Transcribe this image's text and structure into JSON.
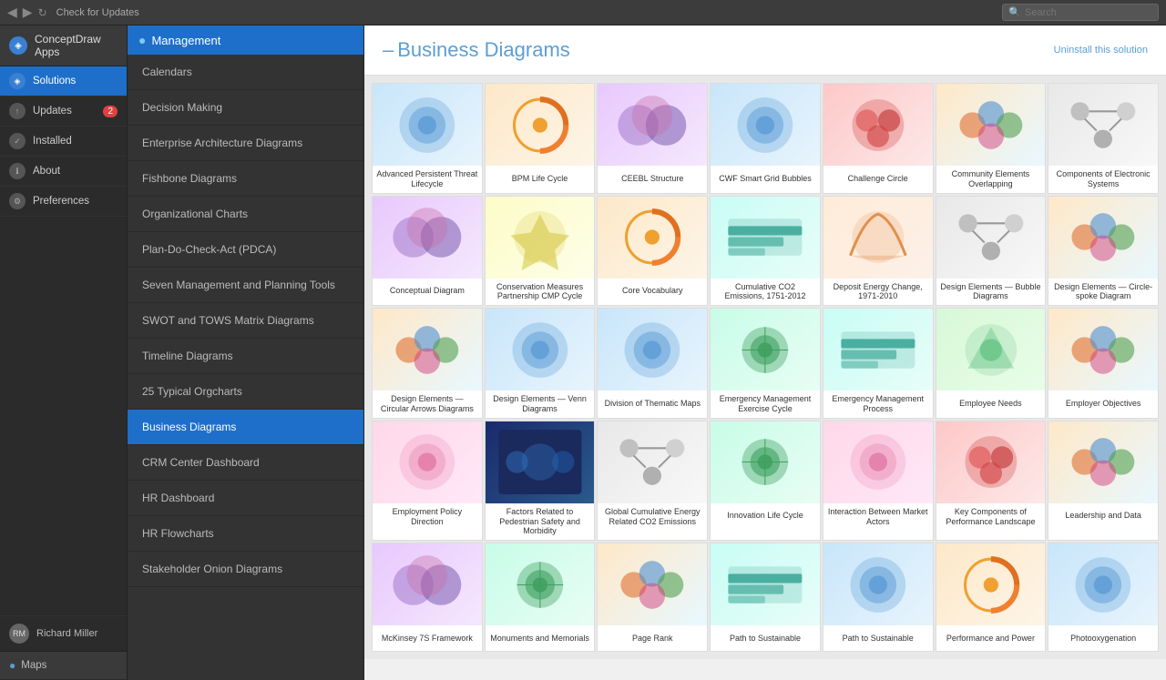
{
  "topbar": {
    "back_label": "◀",
    "forward_label": "▶",
    "refresh_label": "↻",
    "check_label": "Check for Updates",
    "search_placeholder": "Search"
  },
  "sidebar": {
    "app_label": "ConceptDraw Apps",
    "nav_items": [
      {
        "id": "solutions",
        "label": "Solutions",
        "icon": "●",
        "active": true
      },
      {
        "id": "updates",
        "label": "Updates",
        "icon": "↑",
        "badge": "2"
      },
      {
        "id": "installed",
        "label": "Installed",
        "icon": "✓"
      },
      {
        "id": "about",
        "label": "About",
        "icon": "i"
      },
      {
        "id": "preferences",
        "label": "Preferences",
        "icon": "⚙"
      }
    ],
    "user_label": "Richard Miller",
    "bottom_item_label": "Maps"
  },
  "middle_panel": {
    "header_label": "Management",
    "items": [
      {
        "label": "Calendars",
        "active": false
      },
      {
        "label": "Decision Making",
        "active": false
      },
      {
        "label": "Enterprise Architecture Diagrams",
        "active": false
      },
      {
        "label": "Fishbone Diagrams",
        "active": false
      },
      {
        "label": "Organizational Charts",
        "active": false
      },
      {
        "label": "Plan-Do-Check-Act (PDCA)",
        "active": false
      },
      {
        "label": "Seven Management and Planning Tools",
        "active": false
      },
      {
        "label": "SWOT and TOWS Matrix Diagrams",
        "active": false
      },
      {
        "label": "Timeline Diagrams",
        "active": false
      },
      {
        "label": "25 Typical Orgcharts",
        "active": false
      },
      {
        "label": "Business Diagrams",
        "active": true
      },
      {
        "label": "CRM Center Dashboard",
        "active": false
      },
      {
        "label": "HR Dashboard",
        "active": false
      },
      {
        "label": "HR Flowcharts",
        "active": false
      },
      {
        "label": "Stakeholder Onion Diagrams",
        "active": false
      }
    ]
  },
  "content": {
    "title": "Business Diagrams",
    "uninstall_label": "Uninstall this solution",
    "grid_items": [
      {
        "label": "Advanced Persistent Threat Lifecycle",
        "thumb": "blue"
      },
      {
        "label": "BPM Life Cycle",
        "thumb": "orange"
      },
      {
        "label": "CEEBL Structure",
        "thumb": "purple"
      },
      {
        "label": "CWF Smart Grid Bubbles",
        "thumb": "blue"
      },
      {
        "label": "Challenge Circle",
        "thumb": "red"
      },
      {
        "label": "Community Elements Overlapping",
        "thumb": "multi"
      },
      {
        "label": "Components of Electronic Systems",
        "thumb": "gray"
      },
      {
        "label": "Conceptual Diagram",
        "thumb": "purple"
      },
      {
        "label": "Conservation Measures Partnership CMP Cycle",
        "thumb": "yellow"
      },
      {
        "label": "Core Vocabulary",
        "thumb": "orange"
      },
      {
        "label": "Cumulative CO2 Emissions, 1751-2012",
        "thumb": "teal"
      },
      {
        "label": "Deposit Energy Change, 1971-2010",
        "thumb": "warm"
      },
      {
        "label": "Design Elements — Bubble Diagrams",
        "thumb": "gray"
      },
      {
        "label": "Design Elements — Circle-spoke Diagram",
        "thumb": "multi"
      },
      {
        "label": "Design Elements — Circular Arrows Diagrams",
        "thumb": "multi"
      },
      {
        "label": "Design Elements — Venn Diagrams",
        "thumb": "blue"
      },
      {
        "label": "Division of Thematic Maps",
        "thumb": "blue"
      },
      {
        "label": "Emergency Management Exercise Cycle",
        "thumb": "green"
      },
      {
        "label": "Emergency Management Process",
        "thumb": "teal"
      },
      {
        "label": "Employee Needs",
        "thumb": "lightgreen"
      },
      {
        "label": "Employer Objectives",
        "thumb": "multi"
      },
      {
        "label": "Employment Policy Direction",
        "thumb": "pink"
      },
      {
        "label": "Factors Related to Pedestrian Safety and Morbidity",
        "thumb": "darkblue"
      },
      {
        "label": "Global Cumulative Energy Related CO2 Emissions",
        "thumb": "gray"
      },
      {
        "label": "Innovation Life Cycle",
        "thumb": "green"
      },
      {
        "label": "Interaction Between Market Actors",
        "thumb": "pink"
      },
      {
        "label": "Key Components of Performance Landscape",
        "thumb": "red"
      },
      {
        "label": "Leadership and Data",
        "thumb": "multi"
      },
      {
        "label": "McKinsey 7S Framework",
        "thumb": "purple"
      },
      {
        "label": "Monuments and Memorials",
        "thumb": "green"
      },
      {
        "label": "Page Rank",
        "thumb": "multi"
      },
      {
        "label": "Path to Sustainable",
        "thumb": "teal"
      },
      {
        "label": "Path to Sustainable",
        "thumb": "blue"
      },
      {
        "label": "Performance and Power",
        "thumb": "orange"
      },
      {
        "label": "Photooxygenation",
        "thumb": "blue"
      }
    ]
  }
}
